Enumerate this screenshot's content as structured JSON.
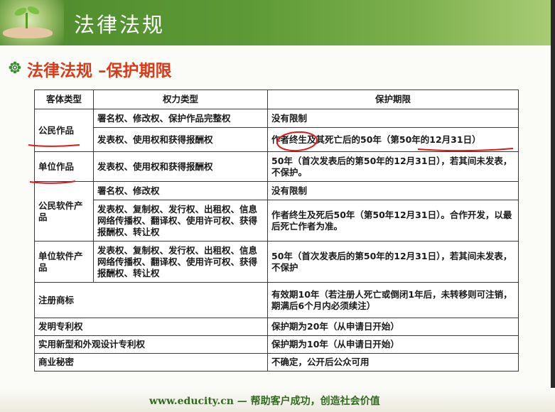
{
  "banner": {
    "title": "法律法规"
  },
  "subtitle": "法律法规 –保护期限",
  "table": {
    "headers": [
      "客体类型",
      "权力类型",
      "保护期限"
    ],
    "rows": {
      "r1": {
        "type": "公民作品",
        "right": "署名权、修改权、保护作品完整权",
        "term": "没有限制"
      },
      "r2": {
        "right": "发表权、使用权和获得报酬权",
        "term": "作者终生及其死亡后的50年（第50年的12月31日）"
      },
      "r3": {
        "type": "单位作品",
        "right": "发表权、使用权和获得报酬权",
        "term": "50年（首次发表后的第50年的12月31日），若其间未发表，不保护。"
      },
      "r4": {
        "type": "公民软件产品",
        "right": "署名权、修改权",
        "term": "没有限制"
      },
      "r5": {
        "right": "发表权、复制权、发行权、出租权、信息网络传播权、翻译权、使用许可权、获得报酬权、转让权",
        "term": "作者终生及死后50年（第50年12月31日）。合作开发，以最后死亡作者为准。"
      },
      "r6": {
        "type": "单位软件产品",
        "right": "发表权、复制权、发行权、出租权、信息网络传播权、翻译权、使用许可权、获得报酬权、转让权",
        "term": "50年（首次发表后的第50年的12月31日），若其间未发表，不保护"
      },
      "r7": {
        "type": "注册商标",
        "term": "有效期10年（若注册人死亡或倒闭1年后，未转移则可注销，期满后6个月内必须续注）"
      },
      "r8": {
        "type": "发明专利权",
        "term": "保护期为20年（从申请日开始）"
      },
      "r9": {
        "type": "实用新型和外观设计专利权",
        "term": "保护期为10年（从申请日开始）"
      },
      "r10": {
        "type": "商业秘密",
        "term": "不确定，公开后公众可用"
      }
    }
  },
  "footer": {
    "url": "www.educity.cn",
    "dash": "—",
    "slogan": "帮助客户成功，创造社会价值"
  },
  "colors": {
    "banner_green": "#5d9a36",
    "title_red": "#d93a1a",
    "ink_red": "#e01818",
    "footer_green": "#2f6a1e"
  }
}
